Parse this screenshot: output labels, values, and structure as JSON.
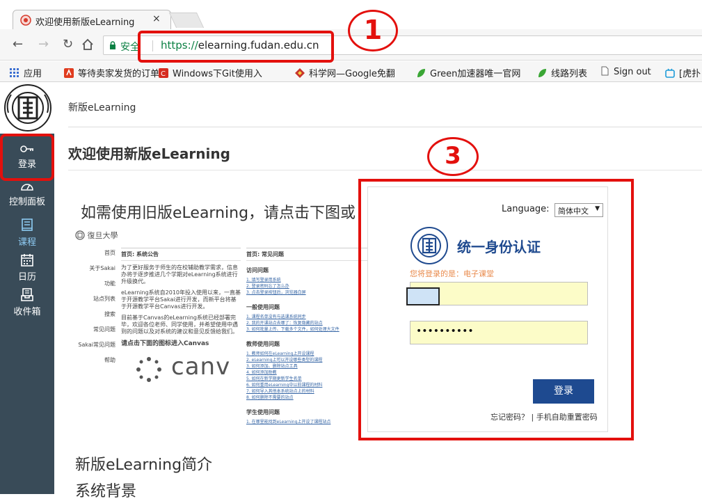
{
  "browser": {
    "tab_title": "欢迎使用新版eLearning",
    "tab_close": "×",
    "secure_label": "安全",
    "url_protocol": "https://",
    "url_host": "elearning.fudan.edu.cn",
    "bookmarks": [
      "应用",
      "等待卖家发货的订单",
      "Windows下Git使用入",
      "科学网—Google免翻",
      "Green加速器唯一官网",
      "线路列表",
      "Sign out",
      "[虎扑"
    ]
  },
  "sidebar": {
    "items": [
      {
        "label": "登录",
        "icon": "key-icon"
      },
      {
        "label": "控制面板",
        "icon": "dashboard-icon"
      },
      {
        "label": "课程",
        "icon": "book-icon"
      },
      {
        "label": "日历",
        "icon": "calendar-icon"
      },
      {
        "label": "收件箱",
        "icon": "inbox-icon"
      }
    ]
  },
  "main": {
    "breadcrumb": "新版eLearning",
    "title": "欢迎使用新版eLearning",
    "old_hint": "如需使用旧版eLearning，请点击下图或",
    "intro_heading": "新版eLearning简介",
    "background_heading": "系统背景"
  },
  "old_portal": {
    "logo_text": "復旦大學",
    "panel1_title": "首页: 系统公告",
    "panel2_title": "首页: 常见问题",
    "menu": [
      "首页",
      "关于Sakai",
      "功能",
      "站点列表",
      "搜索",
      "常见问题",
      "Sakai常见问题",
      "帮助"
    ],
    "notice_p1": "为了更好服务于师生的在校辅助教学需求，信息办将于逐步推进几个学期对eLearning系统进行升级换代。",
    "notice_p2": "eLearning系统自2010年投入使用以来，一直基于开源教学平台Sakai进行开发，而新平台将基于开源教学平台Canvas进行开发。",
    "notice_p3": "目前基于Canvas的eLearning系统已经部署完毕，欢迎各位老师、同学使用，并希望使用中遇到的问题以及对系统的建议和意见反馈给我们。",
    "enter_canvas": "请点击下面的图标进入Canvas",
    "canvas_word": "canv",
    "sections": [
      {
        "title": "访问问题",
        "links": [
          "1. 填写登录用系统",
          "2. 登录密码忘了怎么办",
          "3. 点击登录按钮后，浏览器白屏"
        ]
      },
      {
        "title": "一般使用问题",
        "links": [
          "1. 课程名单没有与选课系统同步",
          "2. 我的开课站点去哪了：恢复隐藏的站点",
          "3. 如何批量上传、下载多个文件，如何处理大文件"
        ]
      },
      {
        "title": "教师使用问题",
        "links": [
          "1. 教师如何在eLearning上开设课程",
          "2. eLearning上可以开设哪些类型的课程",
          "3. 如何添加、删除站点工具",
          "4. 如何添加助教",
          "5. 如何在新学期更新学生名单",
          "6. 如何重用eLearning中以前课程的材料",
          "7. 如何导入其他本系统站点上的材料",
          "8. 如何删除不需要的站点"
        ]
      },
      {
        "title": "学生使用问题",
        "links": [
          "1. 在哪里能找到eLearning上开设了课程站点"
        ]
      }
    ]
  },
  "login_dialog": {
    "language_label": "Language:",
    "language_value": "简体中文",
    "title": "统一身份认证",
    "hint": "您将登录的是：电子课堂",
    "password_mask": "••••••••••",
    "submit": "登录",
    "forgot": "忘记密码？",
    "separator": "|",
    "reset": "手机自助重置密码"
  },
  "annotations": {
    "step1": "1",
    "step3": "3",
    "color": "#e3100d"
  }
}
